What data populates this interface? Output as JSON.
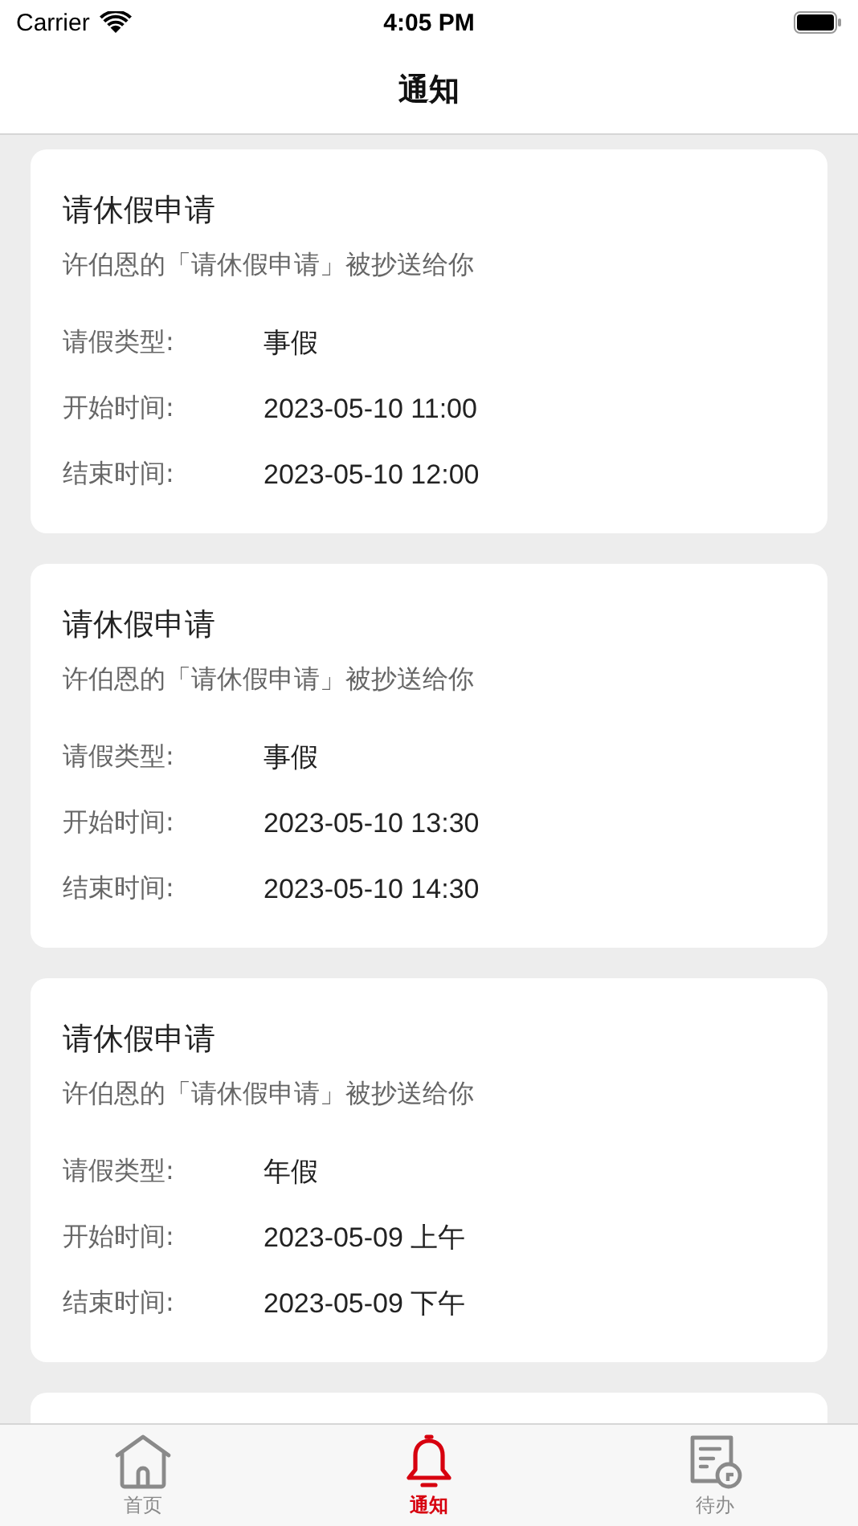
{
  "status_bar": {
    "carrier": "Carrier",
    "time": "4:05 PM"
  },
  "nav": {
    "title": "通知"
  },
  "notifications": [
    {
      "kind": "full",
      "title": "请休假申请",
      "subtitle": "许伯恩的「请休假申请」被抄送给你",
      "fields": [
        {
          "label": "请假类型:",
          "value": "事假"
        },
        {
          "label": "开始时间:",
          "value": "2023-05-10 11:00"
        },
        {
          "label": "结束时间:",
          "value": "2023-05-10 12:00"
        }
      ]
    },
    {
      "kind": "full",
      "title": "请休假申请",
      "subtitle": "许伯恩的「请休假申请」被抄送给你",
      "fields": [
        {
          "label": "请假类型:",
          "value": "事假"
        },
        {
          "label": "开始时间:",
          "value": "2023-05-10 13:30"
        },
        {
          "label": "结束时间:",
          "value": "2023-05-10 14:30"
        }
      ]
    },
    {
      "kind": "full",
      "title": "请休假申请",
      "subtitle": "许伯恩的「请休假申请」被抄送给你",
      "fields": [
        {
          "label": "请假类型:",
          "value": "年假"
        },
        {
          "label": "开始时间:",
          "value": "2023-05-09 上午"
        },
        {
          "label": "结束时间:",
          "value": "2023-05-09 下午"
        }
      ]
    },
    {
      "kind": "cut_off"
    }
  ],
  "tabs": [
    {
      "label": "首页",
      "selected": false
    },
    {
      "label": "通知",
      "selected": true
    },
    {
      "label": "待办",
      "selected": false
    }
  ]
}
